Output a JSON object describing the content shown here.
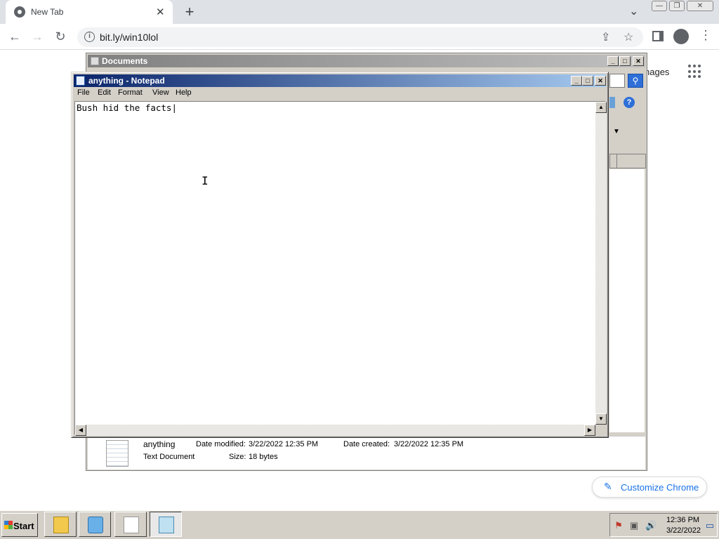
{
  "browser": {
    "tab_title": "New Tab",
    "tab_close": "✕",
    "new_tab": "+",
    "url": "bit.ly/win10lol",
    "images_link": "nages",
    "customize_label": "Customize Chrome",
    "win_min": "—",
    "win_restore": "❐",
    "win_close": "✕"
  },
  "explorer": {
    "title": "Documents",
    "details": {
      "name": "anything",
      "type": "Text Document",
      "modified_label": "Date modified:",
      "modified_value": "3/22/2022 12:35 PM",
      "created_label": "Date created:",
      "created_value": "3/22/2022 12:35 PM",
      "size_label": "Size:",
      "size_value": "18 bytes"
    }
  },
  "notepad": {
    "title": "anything - Notepad",
    "menu": [
      "File",
      "Edit",
      "Format",
      "View",
      "Help"
    ],
    "text": "Bush hid the facts|"
  },
  "taskbar": {
    "start_label": "Start",
    "time": "12:36 PM",
    "date": "3/22/2022"
  },
  "colors": {
    "notepad_title_start": "#0a246a",
    "notepad_title_end": "#a6caf0",
    "chrome_accent": "#1a73e8"
  }
}
